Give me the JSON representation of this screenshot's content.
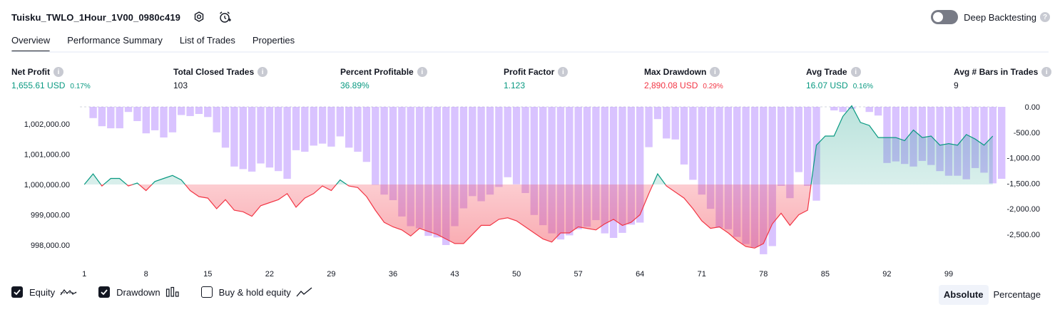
{
  "strategy_title": "Tuisku_TWLO_1Hour_1V00_0980c419",
  "title_icons": [
    "settings-icon",
    "alarm-add-icon"
  ],
  "deep_backtesting": {
    "label": "Deep Backtesting",
    "enabled": false,
    "help_icon": "?"
  },
  "tabs": [
    {
      "label": "Overview",
      "active": true
    },
    {
      "label": "Performance Summary",
      "active": false
    },
    {
      "label": "List of Trades",
      "active": false
    },
    {
      "label": "Properties",
      "active": false
    }
  ],
  "stats": [
    {
      "label": "Net Profit",
      "value": "1,655.61 USD",
      "pct": "0.17%",
      "color": "green"
    },
    {
      "label": "Total Closed Trades",
      "value": "103",
      "pct": "",
      "color": "neutral"
    },
    {
      "label": "Percent Profitable",
      "value": "36.89%",
      "pct": "",
      "color": "green"
    },
    {
      "label": "Profit Factor",
      "value": "1.123",
      "pct": "",
      "color": "green"
    },
    {
      "label": "Max Drawdown",
      "value": "2,890.08 USD",
      "pct": "0.29%",
      "color": "red"
    },
    {
      "label": "Avg Trade",
      "value": "16.07 USD",
      "pct": "0.16%",
      "color": "green"
    },
    {
      "label": "Avg # Bars in Trades",
      "value": "9",
      "pct": "",
      "color": "neutral"
    }
  ],
  "info_icon": "i",
  "chart_data": {
    "type": "line",
    "colors": {
      "up": "#089981",
      "down": "#f23645",
      "drawdown_bar": "#b388ff"
    },
    "left_axis": {
      "ticks": [
        "1,002,000.00",
        "1,001,000.00",
        "1,000,000.00",
        "999,000.00",
        "998,000.00"
      ],
      "values": [
        1002000,
        1001000,
        1000000,
        999000,
        998000
      ],
      "baseline": 1000000
    },
    "right_axis": {
      "ticks": [
        "0.00",
        "-500.00",
        "-1,000.00",
        "-1,500.00",
        "-2,000.00",
        "-2,500.00"
      ],
      "values": [
        0,
        -500,
        -1000,
        -1500,
        -2000,
        -2500
      ]
    },
    "x_ticks": [
      "1",
      "8",
      "15",
      "22",
      "29",
      "36",
      "43",
      "50",
      "57",
      "64",
      "71",
      "78",
      "85",
      "92",
      "99"
    ],
    "x_range": [
      1,
      104
    ],
    "series": [
      {
        "name": "Equity",
        "values": [
          1000000,
          1000350,
          999950,
          1000200,
          1000200,
          999950,
          1000050,
          999800,
          1000100,
          1000200,
          1000300,
          1000150,
          999800,
          999600,
          999550,
          999200,
          999500,
          999150,
          999100,
          998950,
          999300,
          999400,
          999500,
          999700,
          999250,
          999550,
          999700,
          999950,
          999800,
          1000150,
          999950,
          999900,
          999600,
          999150,
          998750,
          998600,
          998500,
          998300,
          998550,
          998450,
          998350,
          998200,
          998050,
          998050,
          998350,
          998650,
          998650,
          998850,
          998900,
          998800,
          998600,
          998400,
          998200,
          998100,
          998400,
          998400,
          998600,
          998550,
          998500,
          998700,
          998850,
          998650,
          998750,
          999000,
          999700,
          1000350,
          999950,
          999750,
          999550,
          999200,
          998800,
          998550,
          998600,
          998400,
          998150,
          997950,
          997900,
          998050,
          998700,
          999050,
          998650,
          999000,
          999150,
          1001300,
          1001600,
          1001600,
          1002250,
          1002600,
          1002050,
          1001950,
          1001550,
          1001550,
          1001550,
          1001450,
          1001800,
          1001550,
          1001600,
          1001300,
          1001350,
          1001300,
          1001650,
          1001500,
          1001300,
          1001600
        ],
        "color_above": "#089981",
        "color_below": "#f23645"
      },
      {
        "name": "Drawdown",
        "values": [
          0,
          -220,
          -380,
          -420,
          -420,
          -100,
          -280,
          -520,
          -460,
          -600,
          -500,
          -160,
          -180,
          -140,
          -200,
          -500,
          -800,
          -1170,
          -1220,
          -1270,
          -1110,
          -1190,
          -1260,
          -1410,
          -850,
          -880,
          -760,
          -720,
          -780,
          -580,
          -800,
          -880,
          -1080,
          -1530,
          -1720,
          -1830,
          -2150,
          -2340,
          -2380,
          -2530,
          -2560,
          -2710,
          -2340,
          -1990,
          -1750,
          -1850,
          -1720,
          -1570,
          -1380,
          -1520,
          -1690,
          -2120,
          -2320,
          -2480,
          -2600,
          -2520,
          -2400,
          -2350,
          -2220,
          -2480,
          -2570,
          -2470,
          -2310,
          -2270,
          -790,
          -240,
          -620,
          -640,
          -1130,
          -1430,
          -1720,
          -2000,
          -2370,
          -2400,
          -2550,
          -2690,
          -2750,
          -2890,
          -2730,
          -1550,
          -1790,
          -1280,
          -1550,
          -1840,
          0,
          -70,
          -100,
          -40,
          0,
          -100,
          -170,
          -1100,
          -1070,
          -1120,
          -1170,
          -1060,
          -1140,
          -1260,
          -1350,
          -1350,
          -1420,
          -1200,
          -1290,
          -1500,
          -1410
        ]
      }
    ]
  },
  "legend": [
    {
      "label": "Equity",
      "checked": true,
      "icon": "equity-line-icon"
    },
    {
      "label": "Drawdown",
      "checked": true,
      "icon": "drawdown-bars-icon"
    },
    {
      "label": "Buy & hold equity",
      "checked": false,
      "icon": "buy-hold-line-icon"
    }
  ],
  "mode_buttons": [
    {
      "label": "Absolute",
      "active": true
    },
    {
      "label": "Percentage",
      "active": false
    }
  ]
}
